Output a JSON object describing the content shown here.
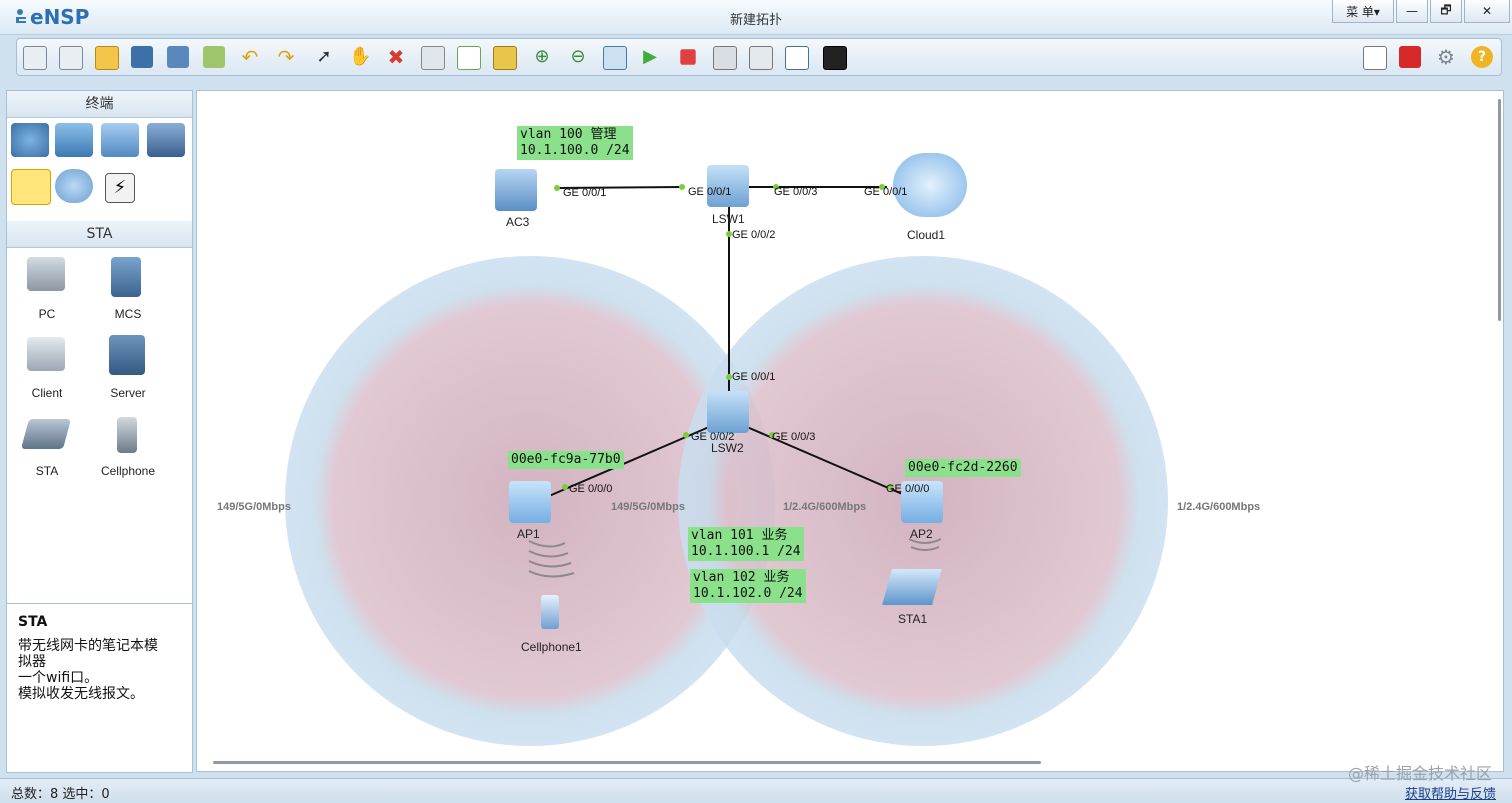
{
  "app": {
    "logo": "eNSP",
    "window_title": "新建拓扑",
    "menu_button": "菜 单▾"
  },
  "window_controls": {
    "minimize": "—",
    "restore": "🗗",
    "close": "✕"
  },
  "toolbar": {
    "left_icons": [
      "new-topology-icon",
      "new-lab-icon",
      "open-icon",
      "save-icon",
      "save-as-icon",
      "print-icon",
      "undo-icon",
      "redo-icon",
      "select-icon",
      "pan-hand-icon",
      "delete-icon",
      "delete-link-icon",
      "text-note-icon",
      "rectangle-icon",
      "zoom-in-icon",
      "zoom-out-icon",
      "fit-view-icon",
      "start-device-icon",
      "stop-device-icon",
      "capture-icon",
      "topology-icon",
      "panel-icon",
      "command-line-icon"
    ],
    "right_icons": [
      "message-icon",
      "huawei-icon",
      "settings-icon",
      "help-icon"
    ]
  },
  "left_panel": {
    "category_header": "终端",
    "category_icons": [
      "router-category-icon",
      "switch-category-icon",
      "wlan-category-icon",
      "firewall-category-icon",
      "terminal-category-icon",
      "cloud-category-icon",
      "connection-category-icon"
    ],
    "device_header": "STA",
    "devices": [
      {
        "label": "PC",
        "icon": "pc-icon"
      },
      {
        "label": "MCS",
        "icon": "mcs-icon"
      },
      {
        "label": "Client",
        "icon": "client-icon"
      },
      {
        "label": "Server",
        "icon": "server-icon"
      },
      {
        "label": "STA",
        "icon": "sta-icon"
      },
      {
        "label": "Cellphone",
        "icon": "cellphone-icon"
      }
    ]
  },
  "description": {
    "title": "STA",
    "lines": [
      "带无线网卡的笔记本模",
      "拟器",
      "一个wifi口。",
      "模拟收发无线报文。"
    ]
  },
  "canvas": {
    "nodes": {
      "ac3": "AC3",
      "lsw1": "LSW1",
      "cloud1": "Cloud1",
      "lsw2": "LSW2",
      "ap1": "AP1",
      "ap2": "AP2",
      "cellphone1": "Cellphone1",
      "sta1": "STA1"
    },
    "ports": {
      "ac3_ge001": "GE 0/0/1",
      "lsw1_ge001": "GE 0/0/1",
      "lsw1_ge003": "GE 0/0/3",
      "cloud1_ge001": "GE 0/0/1",
      "lsw1_ge002": "GE 0/0/2",
      "lsw2_ge001": "GE 0/0/1",
      "lsw2_ge002": "GE 0/0/2",
      "lsw2_ge003": "GE 0/0/3",
      "ap1_ge000": "GE 0/0/0",
      "ap2_ge000": "GE 0/0/0"
    },
    "notes": {
      "mgmt": "vlan 100 管理\n10.1.100.0 /24",
      "ap1_mac": "00e0-fc9a-77b0",
      "ap2_mac": "00e0-fc2d-2260",
      "vlan101": "vlan 101 业务\n10.1.100.1 /24",
      "vlan102": "vlan 102 业务\n10.1.102.0 /24"
    },
    "rates": {
      "ap1_left": "149/5G/0Mbps",
      "ap1_right": "149/5G/0Mbps",
      "ap2_left": "1/2.4G/600Mbps",
      "ap2_right": "1/2.4G/600Mbps"
    }
  },
  "status": {
    "count": "总数：8  选中：0",
    "help_link": "获取帮助与反馈",
    "watermark": "@稀土掘金技术社区"
  },
  "colors": {
    "note_bg": "#8be08b",
    "coverage_outer": "#c5daea",
    "coverage_inner": "#d9b8c6",
    "port_dot": "#7ccd3a"
  }
}
